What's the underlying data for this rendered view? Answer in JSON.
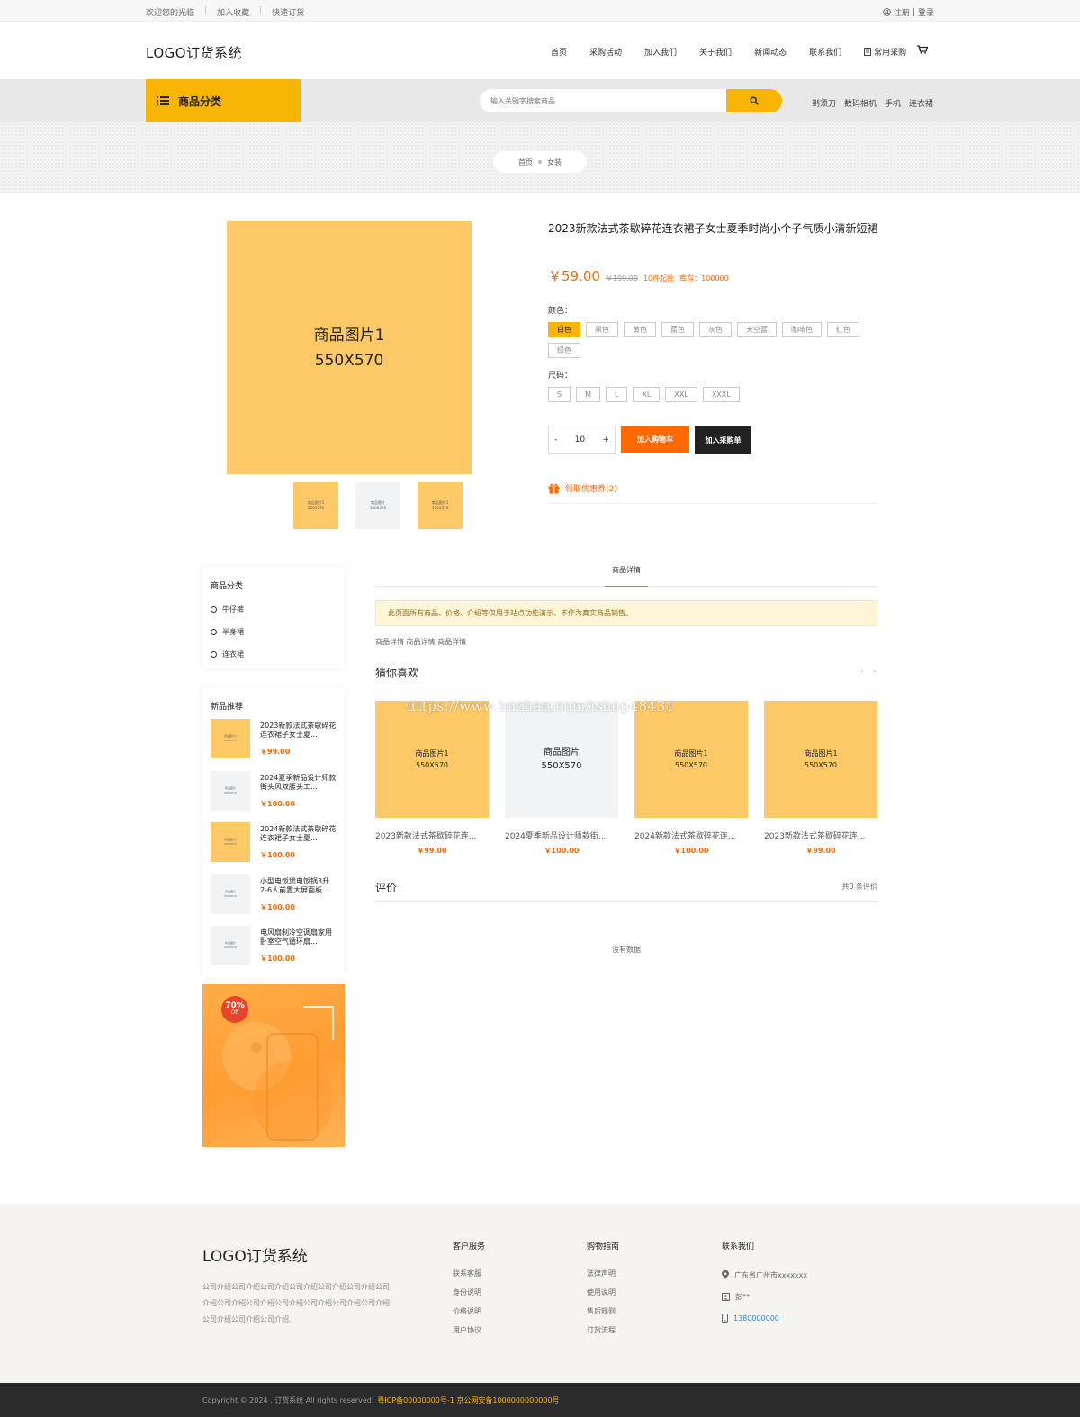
{
  "topbar": {
    "welcome": "欢迎您的光临",
    "favorite": "加入收藏",
    "quick_order": "快速订货",
    "register": "注册",
    "divider": "|",
    "login": "登录"
  },
  "header": {
    "logo": "LOGO订货系统",
    "nav": [
      "首页",
      "采购活动",
      "加入我们",
      "关于我们",
      "新闻动态",
      "联系我们"
    ],
    "common_purchase": "常用采购"
  },
  "catbar": {
    "category_label": "商品分类",
    "search_placeholder": "输入关键字搜索商品",
    "hot_words": [
      "剃须刀",
      "数码相机",
      "手机",
      "连衣裙"
    ]
  },
  "breadcrumb": [
    "首页",
    "女装"
  ],
  "product": {
    "main_image_line1": "商品图片1",
    "main_image_line2": "550X570",
    "thumbs": [
      {
        "line1": "商品图片1",
        "line2": "550X570",
        "color": "#fdc966"
      },
      {
        "line1": "商品图片",
        "line2": "550X570",
        "color": "#f2f3f5"
      },
      {
        "line1": "商品图片1",
        "line2": "550X570",
        "color": "#fdc966"
      }
    ],
    "title": "2023新款法式茶歇碎花连衣裙子女士夏季时尚小个子气质小清新短裙",
    "price": "￥59.00",
    "old_price": "￥199.00",
    "min_order": "10件起批",
    "stock": "库存：100000",
    "color_label": "颜色：",
    "colors": [
      "白色",
      "黑色",
      "黄色",
      "蓝色",
      "灰色",
      "天空蓝",
      "咖啡色",
      "红色",
      "绿色"
    ],
    "selected_color": "白色",
    "size_label": "尺码：",
    "sizes": [
      "S",
      "M",
      "L",
      "XL",
      "XXL",
      "XXXL"
    ],
    "qty_minus": "-",
    "qty_plus": "+",
    "quantity": "10",
    "add_cart": "加入购物车",
    "add_purchase": "加入采购单",
    "coupon": "领取优惠券(2)"
  },
  "sidebar": {
    "category_title": "商品分类",
    "categories": [
      "牛仔裤",
      "半身裙",
      "连衣裙"
    ],
    "new_title": "新品推荐",
    "new_items": [
      {
        "title": "2023新款法式茶歇碎花连衣裙子女士夏...",
        "price": "￥99.00",
        "img1": "商品图片1",
        "img2": "550X570",
        "color": "#fdc966"
      },
      {
        "title": "2024夏季新品设计师款街头风双腰头工...",
        "price": "￥100.00",
        "img1": "商品图片",
        "img2": "550X570",
        "color": "#f2f3f5"
      },
      {
        "title": "2024新款法式茶歇碎花连衣裙子女士夏...",
        "price": "￥100.00",
        "img1": "商品图片1",
        "img2": "550X570",
        "color": "#fdc966"
      },
      {
        "title": "小型电饭煲电饭锅3升2-6人前置大屏面板...",
        "price": "￥100.00",
        "img1": "商品图片",
        "img2": "550X570",
        "color": "#f2f3f5"
      },
      {
        "title": "电风扇制冷空调扇家用卧室空气循环扇...",
        "price": "￥100.00",
        "img1": "商品图片",
        "img2": "550X570",
        "color": "#f2f3f5"
      }
    ],
    "ad_badge_line1": "70%",
    "ad_badge_line2": "Off"
  },
  "detail": {
    "tab": "商品详情",
    "notice": "此页面所有商品、价格、介绍等仅用于站点功能演示，不作为真实商品销售。",
    "text": "商品详情 商品详情 商品详情",
    "guess_title": "猜你喜欢",
    "arrow_prev": "‹",
    "arrow_next": "›",
    "watermark": "https://www.huzhan.com/ishop48431",
    "guess_items": [
      {
        "img1": "商品图片1",
        "img2": "550X570",
        "color": "#fdc966",
        "title": "2023新款法式茶歇碎花连...",
        "price": "￥99.00"
      },
      {
        "img1": "商品图片",
        "img2": "550X570",
        "color": "#f2f3f5",
        "title": "2024夏季新品设计师款街...",
        "price": "￥100.00"
      },
      {
        "img1": "商品图片1",
        "img2": "550X570",
        "color": "#fdc966",
        "title": "2024新款法式茶歇碎花连...",
        "price": "￥100.00"
      },
      {
        "img1": "商品图片1",
        "img2": "550X570",
        "color": "#fdc966",
        "title": "2023新款法式茶歇碎花连...",
        "price": "￥99.00"
      }
    ],
    "review_title": "评价",
    "review_count": "共0 条评价",
    "no_data": "没有数据"
  },
  "footer": {
    "logo": "LOGO订货系统",
    "desc": "公司介绍公司介绍公司介绍公司介绍公司介绍公司介绍公司介绍公司介绍公司介绍公司介绍公司介绍公司介绍公司介绍公司介绍公司介绍公司介绍.",
    "service_title": "客户服务",
    "service_links": [
      "联系客服",
      "身份说明",
      "价格说明",
      "用户协议"
    ],
    "guide_title": "购物指南",
    "guide_links": [
      "法律声明",
      "使用说明",
      "售后规则",
      "订货流程"
    ],
    "contact_title": "联系我们",
    "address": "广东省广州市xxxxxxx",
    "person": "彭**",
    "phone": "1380000000",
    "copyright": "Copyright © 2024 . 订货系统 All rights reserved.",
    "icp": "粤ICP备00000000号-1 京公网安备1000000000000号"
  },
  "colors": {
    "accent": "#f9b506",
    "price": "#ff6a00",
    "placeholder_yellow": "#fdc966",
    "placeholder_gray": "#f2f3f5",
    "dark": "#222222"
  }
}
